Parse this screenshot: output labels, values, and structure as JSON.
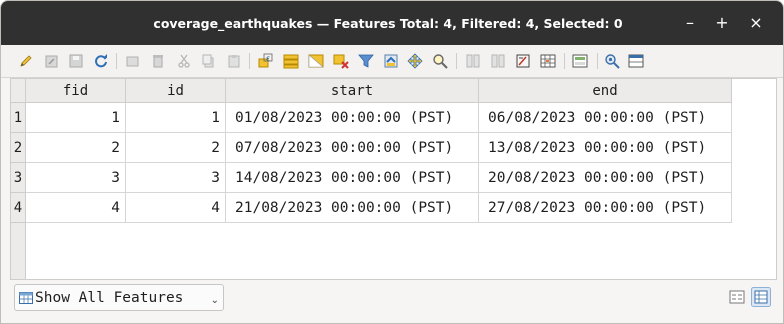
{
  "window": {
    "title": "coverage_earthquakes — Features Total: 4, Filtered: 4, Selected: 0",
    "minimize": "–",
    "maximize": "+",
    "close": "×"
  },
  "toolbar": {
    "icons": [
      "pencil-icon",
      "multi-edit-icon",
      "save-edits-icon",
      "reload-icon",
      "add-feature-icon",
      "delete-feature-icon",
      "cut-icon",
      "copy-icon",
      "paste-icon",
      "expression-select-icon",
      "select-all-icon",
      "invert-selection-icon",
      "deselect-all-icon",
      "filter-select-icon",
      "move-selection-to-top-icon",
      "pan-to-selection-icon",
      "zoom-to-selection-icon",
      "new-field-icon",
      "delete-field-icon",
      "field-calculator-icon",
      "conditional-formatting-icon",
      "dock-table-icon",
      "actions-icon",
      "organize-columns-icon"
    ]
  },
  "table": {
    "columns": [
      "fid",
      "id",
      "start",
      "end"
    ],
    "rows": [
      {
        "row_label": "1",
        "fid": "1",
        "id": "1",
        "start": "01/08/2023 00:00:00 (PST)",
        "end": "06/08/2023 00:00:00 (PST)"
      },
      {
        "row_label": "2",
        "fid": "2",
        "id": "2",
        "start": "07/08/2023 00:00:00 (PST)",
        "end": "13/08/2023 00:00:00 (PST)"
      },
      {
        "row_label": "3",
        "fid": "3",
        "id": "3",
        "start": "14/08/2023 00:00:00 (PST)",
        "end": "20/08/2023 00:00:00 (PST)"
      },
      {
        "row_label": "4",
        "fid": "4",
        "id": "4",
        "start": "21/08/2023 00:00:00 (PST)",
        "end": "27/08/2023 00:00:00 (PST)"
      }
    ]
  },
  "footer": {
    "filter_combo": "Show All Features",
    "view_buttons": [
      "form-view-icon",
      "table-view-icon"
    ]
  },
  "colors": {
    "titlebar": "#303030",
    "header_bg": "#ecebe9",
    "accent": "#3f7fbf"
  }
}
